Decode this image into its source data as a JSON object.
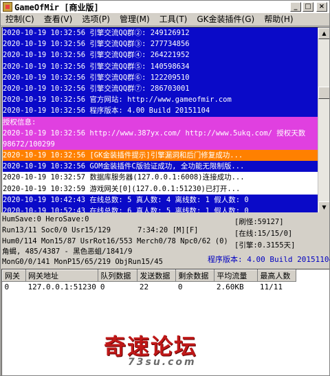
{
  "window": {
    "title": "GameOfMir [商业版]",
    "controls": {
      "minimize": "_",
      "maximize": "□",
      "close": "×"
    }
  },
  "menu": [
    "控制(C)",
    "查看(V)",
    "选项(P)",
    "管理(M)",
    "工具(T)",
    "GK金装插件(G)",
    "帮助(H)"
  ],
  "log": {
    "lines": [
      {
        "text": "2020-10-19 10:32:56 引擎交流QQ群②: 249126912",
        "style": "blue"
      },
      {
        "text": "2020-10-19 10:32:56 引擎交流QQ群③: 277734856",
        "style": "blue"
      },
      {
        "text": "2020-10-19 10:32:56 引擎交流QQ群④: 264221952",
        "style": "blue"
      },
      {
        "text": "2020-10-19 10:32:56 引擎交流QQ群⑤: 140598634",
        "style": "blue"
      },
      {
        "text": "2020-10-19 10:32:56 引擎交流QQ群⑥: 122209510",
        "style": "blue"
      },
      {
        "text": "2020-10-19 10:32:56 引擎交流QQ群⑦: 286703001",
        "style": "blue"
      },
      {
        "text": "2020-10-19 10:32:56 官方网站: http://www.gameofmir.com",
        "style": "blue"
      },
      {
        "text": "2020-10-19 10:32:56 程序版本: 4.00 Build 20151104",
        "style": "blue"
      },
      {
        "text": "授权信息:",
        "style": "magenta"
      },
      {
        "text": "2020-10-19 10:32:56 http://www.387yx.com/ http://www.5ukq.com/ 授权天数 98672/100299",
        "style": "magenta",
        "wrap": true
      },
      {
        "text": "2020-10-19 10:32:56 [GK金装插件提示]引擎漏洞和后门修复成功...",
        "style": "orange"
      },
      {
        "text": "2020-10-19 10:32:56 GOM金装插件C版验证成功, 全功能无限制版...",
        "style": "blue"
      },
      {
        "text": "2020-10-19 10:32:57 数据库服务器(127.0.0.1:6008)连接成功...",
        "style": "white"
      },
      {
        "text": "2020-10-19 10:32:59 游戏网关[0](127.0.0.1:51230)已打开...",
        "style": "white"
      },
      {
        "text": "2020-10-19 10:42:43 在线总数: 5 真人数: 4 离线数: 1 假人数: 0",
        "style": "blue"
      },
      {
        "text": "2020-10-19 10:52:43 在线总数: 6 真人数: 5 离线数: 1 假人数: 0",
        "style": "blue"
      }
    ]
  },
  "status": {
    "humsave": "HumSave:0 HeroSave:0",
    "run": "Run13/11 Soc0/0 Usr15/129",
    "time": "7:34:20 [M][F]",
    "hum": "Hum0/114 Mon15/87 UsrRot16/553 Merch0/78 Npc0/62 (0)",
    "role": "角蝎, 485/4387 - 黑色恶蛆/1841/9",
    "mon": "MonG0/0/141 MonP15/65/219 ObjRun15/45",
    "refresh": "[刷怪:59127]",
    "online": "[在线:15/15/0]",
    "engine": "[引擎:0.3155天]",
    "version": "程序版本: 4.00 Build 20151104"
  },
  "table": {
    "headers": [
      "网关",
      "网关地址",
      "队列数据",
      "发送数据",
      "剩余数据",
      "平均流量",
      "最高人数"
    ],
    "rows": [
      [
        "0",
        "127.0.0.1:51230",
        "0",
        "22",
        "0",
        "2.60KB",
        "11/11"
      ]
    ]
  },
  "watermark": {
    "text": "奇速论坛",
    "url": "73su.com"
  },
  "colors": {
    "blue": "#0a0ac8",
    "magenta": "#e040e0",
    "orange": "#ff8000",
    "version": "#0000c0"
  }
}
